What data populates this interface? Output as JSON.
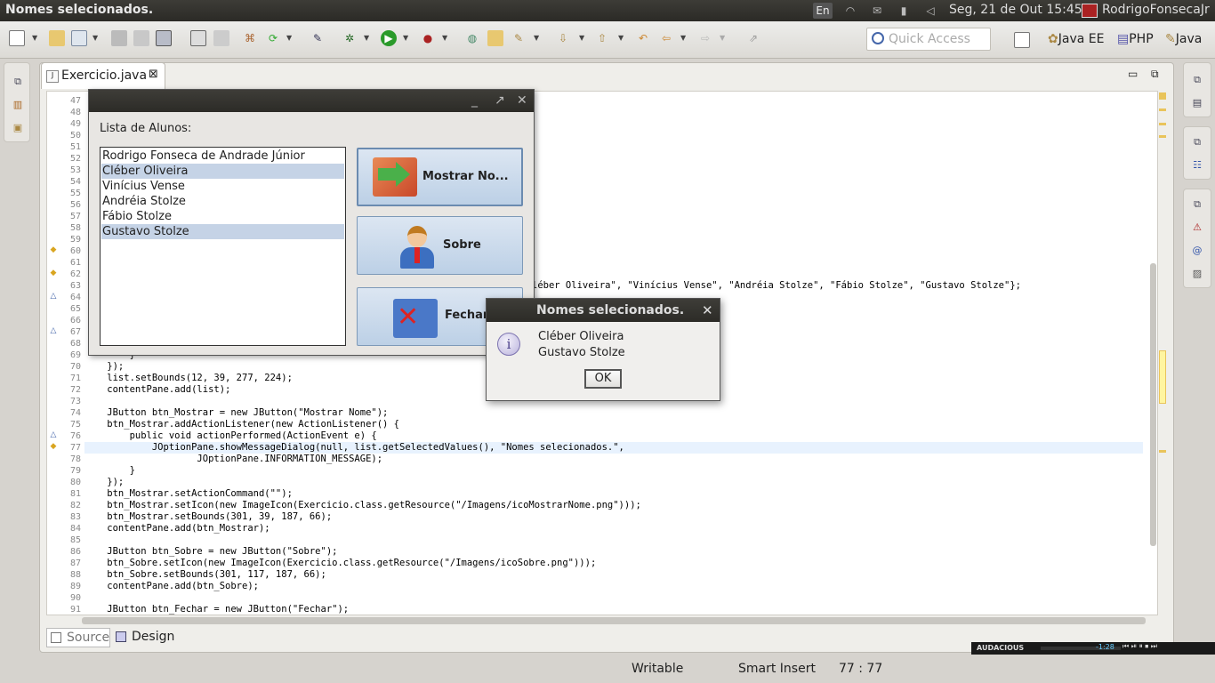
{
  "topbar": {
    "window_title": "Nomes selecionados.",
    "keyboard": "En",
    "datetime": "Seg, 21 de Out  15:45",
    "user": "RodrigoFonsecaJr"
  },
  "toolbar": {
    "quick_access_placeholder": "Quick Access",
    "perspectives": [
      "Java EE",
      "PHP",
      "Java"
    ]
  },
  "editor": {
    "tab_label": "Exercicio.java",
    "source_tab": "Source",
    "design_tab": "Design",
    "lines": [
      {
        "n": "47",
        "html": ""
      },
      {
        "n": "48",
        "html": ""
      },
      {
        "n": "49",
        "html": ""
      },
      {
        "n": "50",
        "html": ""
      },
      {
        "n": "51",
        "html": ""
      },
      {
        "n": "52",
        "html": ""
      },
      {
        "n": "53",
        "html": ""
      },
      {
        "n": "54",
        "html": ""
      },
      {
        "n": "55",
        "html": ""
      },
      {
        "n": "56",
        "html": ""
      },
      {
        "n": "57",
        "html": ""
      },
      {
        "n": "58",
        "html": ""
      },
      {
        "n": "59",
        "html": ""
      },
      {
        "n": "60",
        "html": ""
      },
      {
        "n": "61",
        "html": ""
      },
      {
        "n": "62",
        "html": ""
      },
      {
        "n": "63",
        "html": ""
      },
      {
        "n": "64",
        "html": ""
      },
      {
        "n": "65",
        "html": ""
      },
      {
        "n": "66",
        "html": ""
      },
      {
        "n": "67",
        "html": ""
      },
      {
        "n": "68",
        "html": ""
      },
      {
        "n": "69",
        "html": "        }"
      },
      {
        "n": "70",
        "html": "    });"
      },
      {
        "n": "71",
        "html": "    list.setBounds(12, 39, 277, 224);"
      },
      {
        "n": "72",
        "html": "    contentPane.add(list);"
      },
      {
        "n": "73",
        "html": ""
      },
      {
        "n": "74",
        "html": "    JButton btn_Mostrar = new JButton(\"Mostrar Nome\");"
      },
      {
        "n": "75",
        "html": "    btn_Mostrar.addActionListener(new ActionListener() {"
      },
      {
        "n": "76",
        "html": "        public void actionPerformed(ActionEvent e) {"
      },
      {
        "n": "77",
        "html": "            JOptionPane.showMessageDialog(null, list.getSelectedValues(), \"Nomes selecionados.\","
      },
      {
        "n": "78",
        "html": "                    JOptionPane.INFORMATION_MESSAGE);"
      },
      {
        "n": "79",
        "html": "        }"
      },
      {
        "n": "80",
        "html": "    });"
      },
      {
        "n": "81",
        "html": "    btn_Mostrar.setActionCommand(\"\");"
      },
      {
        "n": "82",
        "html": "    btn_Mostrar.setIcon(new ImageIcon(Exercicio.class.getResource(\"/Imagens/icoMostrarNome.png\")));"
      },
      {
        "n": "83",
        "html": "    btn_Mostrar.setBounds(301, 39, 187, 66);"
      },
      {
        "n": "84",
        "html": "    contentPane.add(btn_Mostrar);"
      },
      {
        "n": "85",
        "html": ""
      },
      {
        "n": "86",
        "html": "    JButton btn_Sobre = new JButton(\"Sobre\");"
      },
      {
        "n": "87",
        "html": "    btn_Sobre.setIcon(new ImageIcon(Exercicio.class.getResource(\"/Imagens/icoSobre.png\")));"
      },
      {
        "n": "88",
        "html": "    btn_Sobre.setBounds(301, 117, 187, 66);"
      },
      {
        "n": "89",
        "html": "    contentPane.add(btn_Sobre);"
      },
      {
        "n": "90",
        "html": ""
      },
      {
        "n": "91",
        "html": "    JButton btn_Fechar = new JButton(\"Fechar\");"
      }
    ],
    "line63_tail": "léber Oliveira\", \"Vinícius Vense\", \"Andréia Stolze\", \"Fábio Stolze\", \"Gustavo Stolze\"};"
  },
  "status": {
    "writable": "Writable",
    "insert_mode": "Smart Insert",
    "position": "77 : 77"
  },
  "audacious": {
    "label": "AUDACIOUS",
    "time": "-1:28"
  },
  "app": {
    "list_label": "Lista de Alunos:",
    "students": [
      {
        "name": "Rodrigo Fonseca de Andrade Júnior",
        "selected": false
      },
      {
        "name": "Cléber Oliveira",
        "selected": true
      },
      {
        "name": "Vinícius Vense",
        "selected": false
      },
      {
        "name": "Andréia Stolze",
        "selected": false
      },
      {
        "name": "Fábio Stolze",
        "selected": false
      },
      {
        "name": "Gustavo Stolze",
        "selected": true
      }
    ],
    "btn_mostrar": "Mostrar No...",
    "btn_sobre": "Sobre",
    "btn_fechar": "Fechar"
  },
  "dialog": {
    "title": "Nomes selecionados.",
    "messages": [
      "Cléber Oliveira",
      "Gustavo Stolze"
    ],
    "ok": "OK"
  },
  "colors": {
    "selection": "#c5d3e6",
    "titlebar": "#3c3b37"
  }
}
